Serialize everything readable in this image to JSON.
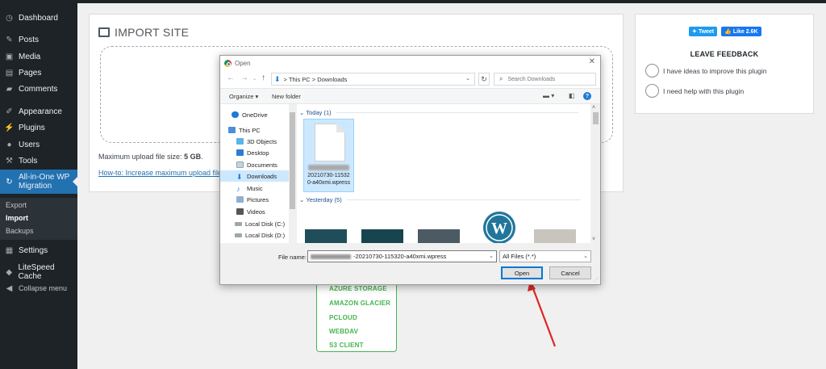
{
  "sidebar": {
    "items": [
      {
        "label": "Dashboard",
        "icon": "dashboard-icon"
      },
      {
        "label": "Posts",
        "icon": "pin-icon"
      },
      {
        "label": "Media",
        "icon": "media-icon"
      },
      {
        "label": "Pages",
        "icon": "pages-icon"
      },
      {
        "label": "Comments",
        "icon": "comment-icon"
      },
      {
        "label": "Appearance",
        "icon": "brush-icon"
      },
      {
        "label": "Plugins",
        "icon": "plugin-icon"
      },
      {
        "label": "Users",
        "icon": "user-icon"
      },
      {
        "label": "Tools",
        "icon": "wrench-icon"
      },
      {
        "label": "All-in-One WP Migration",
        "icon": "migration-icon"
      },
      {
        "label": "Settings",
        "icon": "settings-icon"
      },
      {
        "label": "LiteSpeed Cache",
        "icon": "litespeed-icon"
      },
      {
        "label": "Collapse menu",
        "icon": "collapse-icon"
      }
    ],
    "submenu": [
      "Export",
      "Import",
      "Backups"
    ]
  },
  "panel": {
    "title": "IMPORT SITE",
    "max_upload_label": "Maximum upload file size:",
    "max_upload_value": "5 GB",
    "max_upload_suffix": ".",
    "howto_link": "How-to: Increase maximum upload file size"
  },
  "import_options": [
    "AZURE STORAGE",
    "AMAZON GLACIER",
    "PCLOUD",
    "WEBDAV",
    "S3 CLIENT"
  ],
  "feedback": {
    "tweet": "Tweet",
    "like": "Like 2.6K",
    "title": "LEAVE FEEDBACK",
    "options": [
      "I have ideas to improve this plugin",
      "I need help with this plugin"
    ]
  },
  "dialog": {
    "title": "Open",
    "address": {
      "root": "This PC",
      "folder": "Downloads",
      "separator": ">"
    },
    "search_placeholder": "Search Downloads",
    "toolbar": {
      "organize": "Organize ▾",
      "new_folder": "New folder"
    },
    "nav_pane": [
      "OneDrive",
      "This PC",
      "3D Objects",
      "Desktop",
      "Documents",
      "Downloads",
      "Music",
      "Pictures",
      "Videos",
      "Local Disk (C:)",
      "Local Disk (D:)"
    ],
    "groups": {
      "today": "Today (1)",
      "yesterday": "Yesterday (5)"
    },
    "selected_file": {
      "line1": "20210730-11532",
      "line2": "0-a40xmi.wpress"
    },
    "file_name_label": "File name:",
    "file_name_value": "-20210730-115320-a40xmi.wpress",
    "filter": "All Files (*.*)",
    "open_button": "Open",
    "cancel_button": "Cancel"
  },
  "colors": {
    "sidebar_bg": "#1d2327",
    "active_blue": "#2271b1",
    "import_green": "#46b450",
    "arrow_red": "#e02424"
  }
}
